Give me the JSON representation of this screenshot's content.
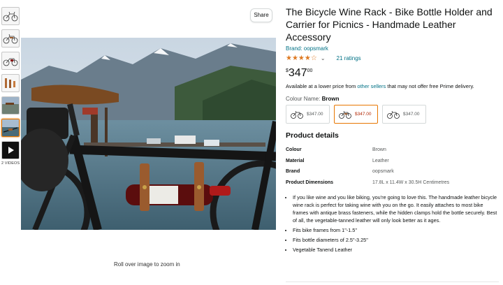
{
  "gallery": {
    "thumbnails": [
      "bike-with-rack-thumb",
      "bike-with-rack-thumb",
      "bike-with-rack-thumb",
      "leather-straps-thumb",
      "bike-scene-thumb",
      "bike-scene-thumb"
    ],
    "active_index": 5,
    "videos_label": "2 VIDEOS",
    "share_label": "Share",
    "zoom_hint": "Roll over image to zoom in"
  },
  "product": {
    "title": "The Bicycle Wine Rack - Bike Bottle Holder and Carrier for Picnics - Handmade Leather Accessory",
    "brand_text": "Brand: oopsmark",
    "rating": {
      "stars": "★★★★☆",
      "chevron": "⌄",
      "count_text": "21 ratings"
    },
    "price": {
      "symbol": "$",
      "whole": "347",
      "fraction": "00"
    },
    "availability": {
      "prefix": "Available at a lower price from ",
      "link": "other sellers",
      "suffix": " that may not offer free Prime delivery."
    },
    "color": {
      "label": "Colour Name: ",
      "value": "Brown"
    },
    "swatches": [
      {
        "price": "$347.00",
        "selected": false
      },
      {
        "price": "$347.00",
        "selected": true
      },
      {
        "price": "$347.00",
        "selected": false
      }
    ],
    "details_title": "Product details",
    "details": [
      {
        "key": "Colour",
        "value": "Brown"
      },
      {
        "key": "Material",
        "value": "Leather"
      },
      {
        "key": "Brand",
        "value": "oopsmark"
      },
      {
        "key": "Product Dimensions",
        "value": "17.8L x 11.4W x 30.5H Centimetres"
      }
    ],
    "bullets": [
      "If you like wine and you like biking, you're going to love this. The handmade leather bicycle wine rack is perfect for taking wine with you on the go. It easily attaches to most bike frames with antique brass fasteners, while the hidden clamps hold the bottle securely. Best of all, the vegetable-tanned leather will only look better as it ages.",
      "Fits bike frames from 1\"-1.5\"",
      "Fits bottle diameters of 2.5\"-3.25\"",
      "Vegetable Tanend Leather"
    ]
  },
  "colors": {
    "link": "#007185",
    "star": "#de7921",
    "selected_border": "#e77600",
    "price_selected": "#b12704",
    "leather": "#9a5b2e"
  }
}
